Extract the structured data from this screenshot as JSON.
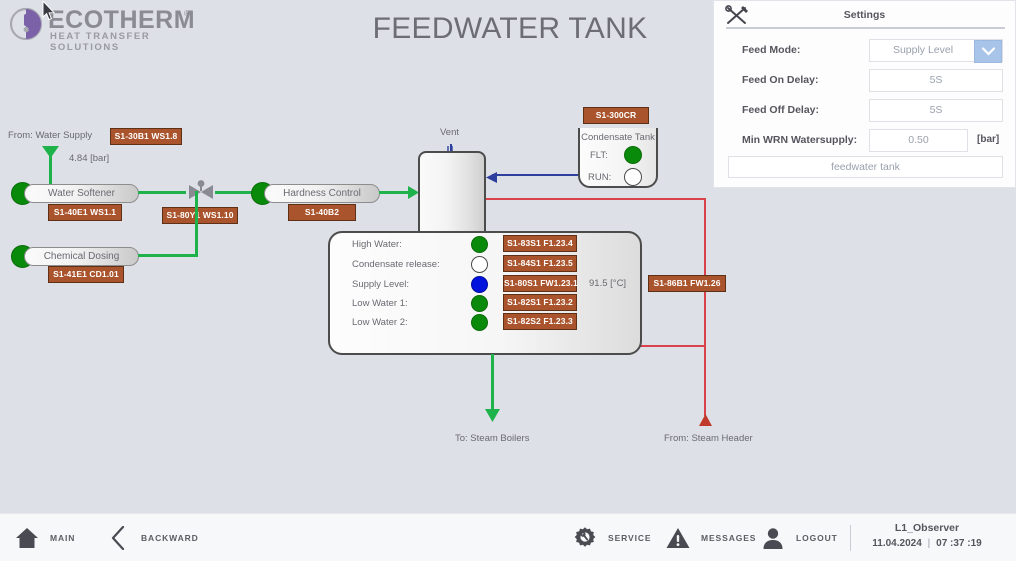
{
  "brand": {
    "name": "ECOTHERM",
    "trademark": "®",
    "tagline": "HEAT TRANSFER SOLUTIONS",
    "logo_icon": "ecotherm-logo-icon",
    "accent": "#7b61a8"
  },
  "header": {
    "title": "FEEDWATER TANK"
  },
  "cursor": {
    "icon": "mouse-pointer-icon"
  },
  "settings": {
    "title": "Settings",
    "tools_icon": "tools-icon",
    "rows": [
      {
        "label": "Feed Mode:",
        "value": "Supply Level",
        "unit": "",
        "type": "select"
      },
      {
        "label": "Feed On Delay:",
        "value": "5S",
        "unit": "",
        "type": "input"
      },
      {
        "label": "Feed Off Delay:",
        "value": "5S",
        "unit": "",
        "type": "input"
      },
      {
        "label": "Min WRN Watersupply:",
        "value": "0.50",
        "unit": "[bar]",
        "type": "input"
      }
    ],
    "footer_field": "feedwater tank",
    "chevron_icon": "chevron-down-icon"
  },
  "diagram": {
    "source_label": "From: Water Supply",
    "source_tag": "S1-30B1 WS1.8",
    "source_pressure": "4.84 [bar]",
    "equipment": [
      {
        "name": "Water Softener",
        "tag": "S1-40E1 WS1.1",
        "state": "green"
      },
      {
        "name": "Chemical Dosing",
        "tag": "S1-41E1 CD1.01",
        "state": "green"
      },
      {
        "name": "Hardness Control",
        "tag": "S1-40B2",
        "state": "green"
      }
    ],
    "valve_tag": "S1-80Y1 WS1.10",
    "valve_icon": "valve-icon",
    "vent_label": "Vent",
    "vent_icon": "vent-icon",
    "condensate_tank": {
      "tag": "S1-300CR",
      "title": "Condensate Tank",
      "signals": [
        {
          "label": "FLT:",
          "state": "green"
        },
        {
          "label": "RUN:",
          "state": "hollow"
        }
      ]
    },
    "status_rows": [
      {
        "label": "High Water:",
        "state": "green",
        "tag": "S1-83S1 F1.23.4"
      },
      {
        "label": "Condensate release:",
        "state": "hollow",
        "tag": "S1-84S1 F1.23.5"
      },
      {
        "label": "Supply Level:",
        "state": "blue",
        "tag": "S1-80S1 FW1.23.1"
      },
      {
        "label": "Low Water 1:",
        "state": "green",
        "tag": "S1-82S1 F1.23.2"
      },
      {
        "label": "Low Water 2:",
        "state": "green",
        "tag": "S1-82S2 F1.23.3"
      }
    ],
    "temperature": "91.5 [°C]",
    "steam_header_tag": "S1-86B1 FW1.26",
    "outlet_label": "To: Steam Boilers",
    "inlet_label": "From: Steam Header"
  },
  "footer": {
    "buttons": [
      {
        "label": "MAIN",
        "icon": "home-icon"
      },
      {
        "label": "BACKWARD",
        "icon": "chevron-left-icon"
      },
      {
        "label": "SERVICE",
        "icon": "gear-wrench-icon"
      },
      {
        "label": "MESSAGES",
        "icon": "warning-triangle-icon"
      },
      {
        "label": "LOGOUT",
        "icon": "user-icon"
      }
    ],
    "user": "L1_Observer",
    "date": "11.04.2024",
    "time": "07 :37 :19",
    "datetime_separator": "|"
  }
}
